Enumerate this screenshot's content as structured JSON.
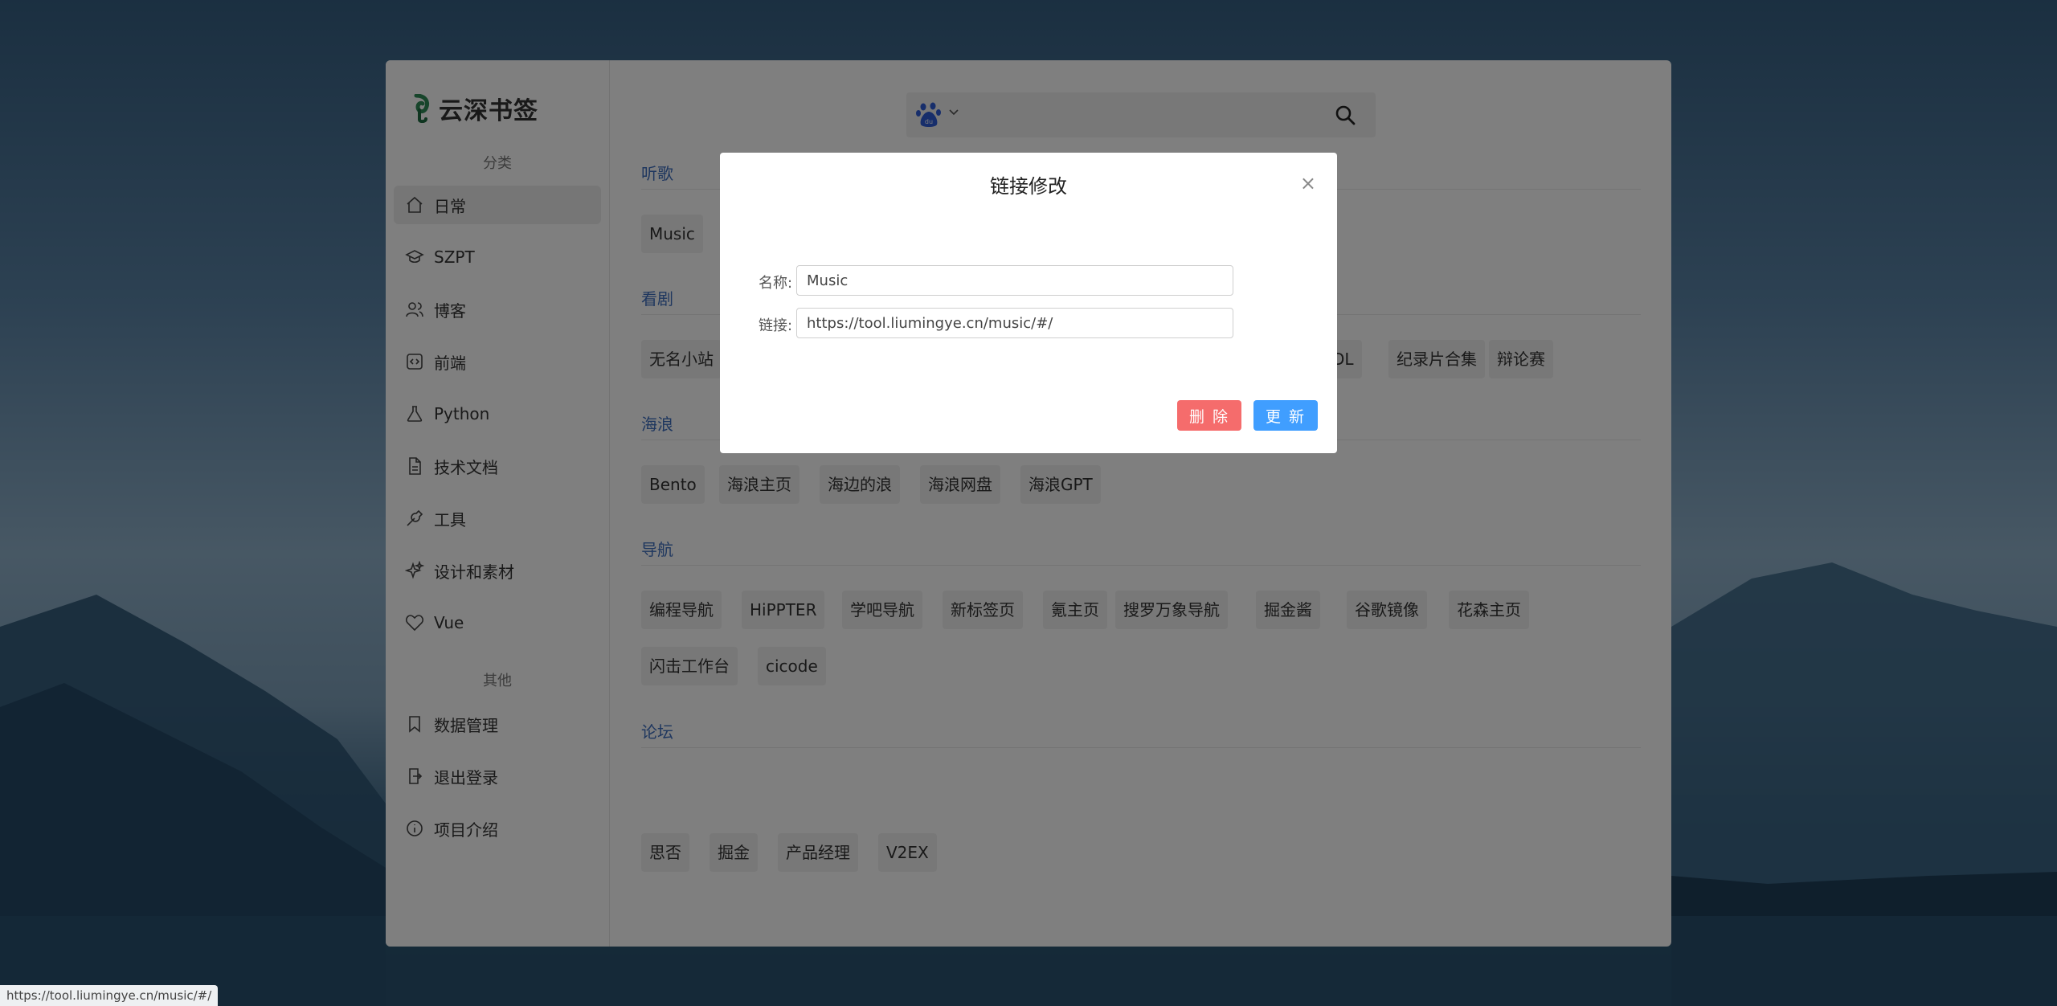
{
  "app": {
    "title": "云深书签"
  },
  "sidebar": {
    "section_categories": "分类",
    "section_other": "其他",
    "items": [
      {
        "label": "日常",
        "icon": "home-icon",
        "active": true
      },
      {
        "label": "SZPT",
        "icon": "graduation-cap-icon"
      },
      {
        "label": "博客",
        "icon": "users-icon"
      },
      {
        "label": "前端",
        "icon": "code-icon"
      },
      {
        "label": "Python",
        "icon": "flask-icon"
      },
      {
        "label": "技术文档",
        "icon": "document-icon"
      },
      {
        "label": "工具",
        "icon": "wrench-icon"
      },
      {
        "label": "设计和素材",
        "icon": "sparkles-icon"
      },
      {
        "label": "Vue",
        "icon": "heart-icon"
      }
    ],
    "other_items": [
      {
        "label": "数据管理",
        "icon": "bookmark-icon"
      },
      {
        "label": "退出登录",
        "icon": "logout-icon"
      },
      {
        "label": "项目介绍",
        "icon": "info-icon"
      }
    ]
  },
  "search": {
    "engine_icon": "baidu-paw-icon",
    "placeholder": ""
  },
  "categories": [
    {
      "title": "听歌",
      "links": [
        "Music"
      ]
    },
    {
      "title": "看剧",
      "links": [
        "无名小站",
        "DL",
        "纪录片合集",
        "辩论赛"
      ]
    },
    {
      "title": "海浪",
      "links": [
        "Bento",
        "海浪主页",
        "海边的浪",
        "海浪网盘",
        "海浪GPT"
      ]
    },
    {
      "title": "导航",
      "links": [
        "编程导航",
        "HiPPTER",
        "学吧导航",
        "新标签页",
        "氪主页",
        "搜罗万象导航",
        "掘金酱",
        "谷歌镜像",
        "花森主页",
        "闪击工作台",
        "cicode"
      ]
    },
    {
      "title": "论坛",
      "links": [
        "思否",
        "掘金",
        "产品经理",
        "V2EX"
      ]
    }
  ],
  "modal": {
    "title": "链接修改",
    "close": "×",
    "name_label": "名称:",
    "name_value": "Music",
    "link_label": "链接:",
    "link_value": "https://tool.liumingye.cn/music/#/",
    "delete_label": "删 除",
    "update_label": "更 新"
  },
  "statusbar": {
    "url": "https://tool.liumingye.cn/music/#/"
  },
  "colors": {
    "accent": "#409eff",
    "danger": "#f56c6c",
    "category": "#3f6fbf"
  }
}
